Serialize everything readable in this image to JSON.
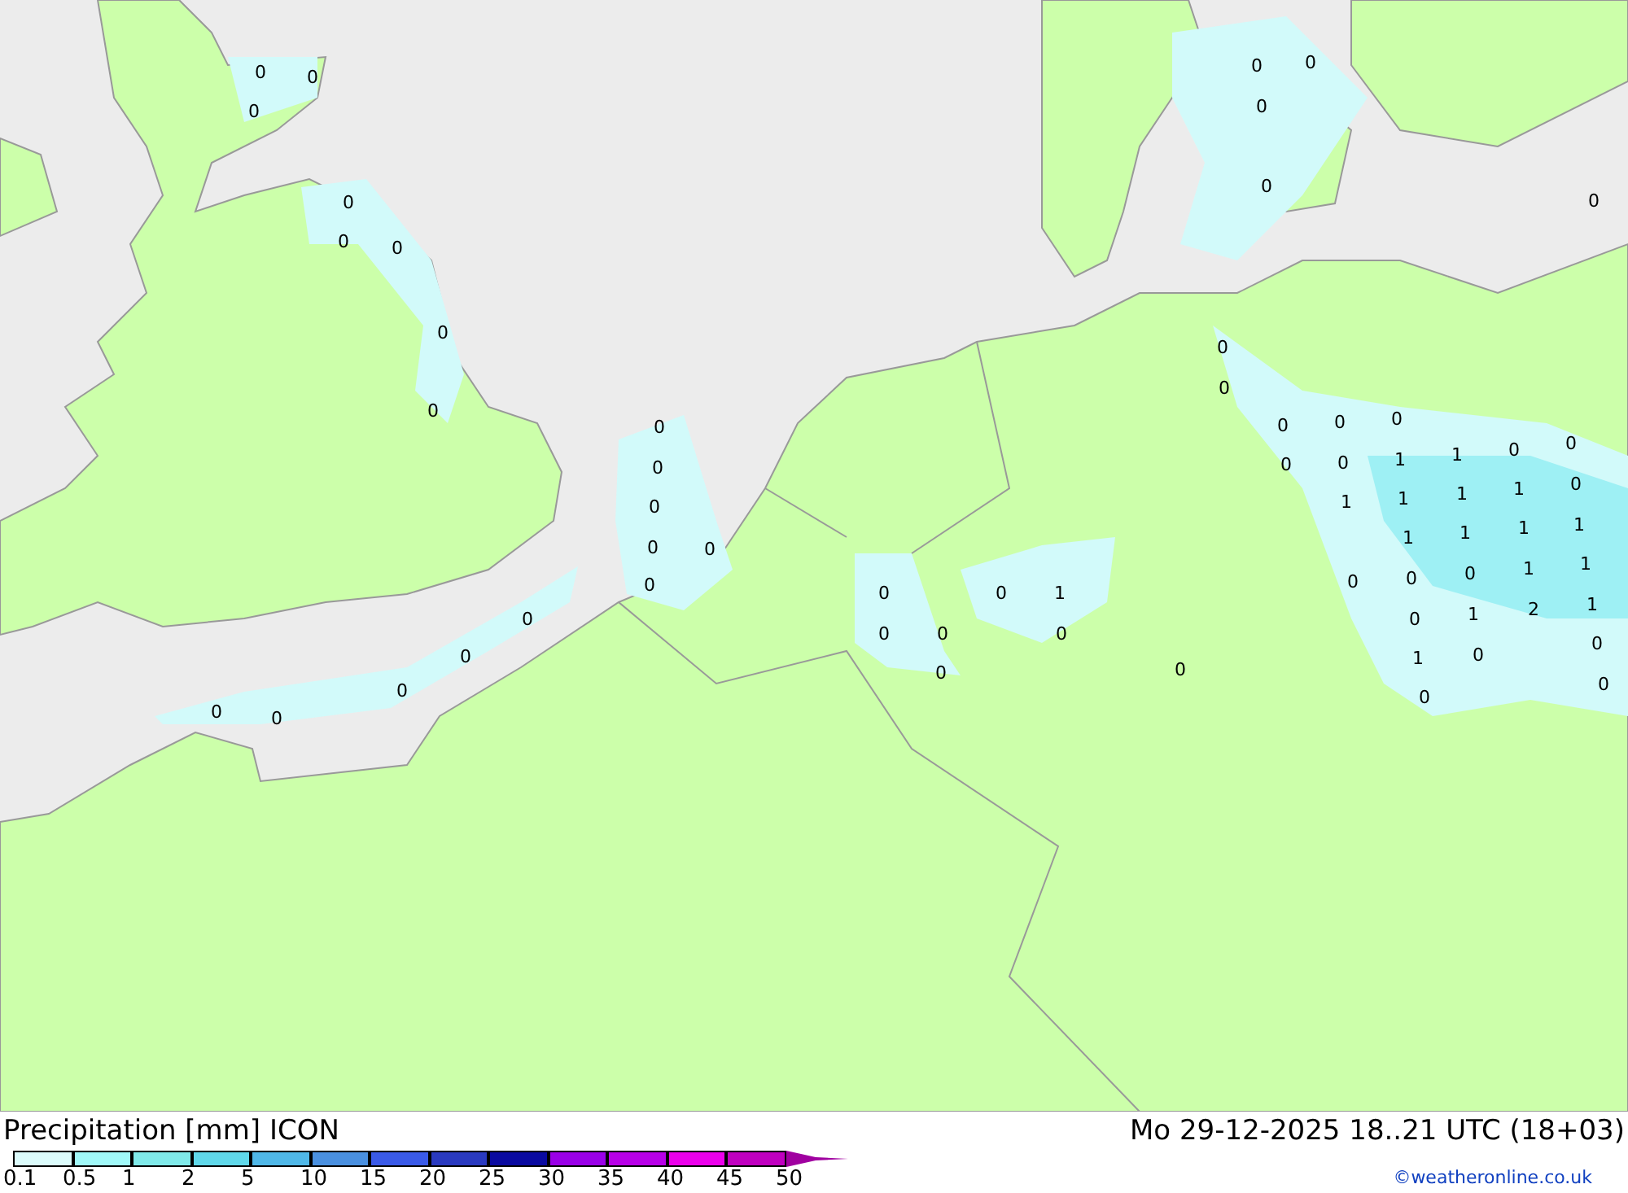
{
  "map": {
    "values": [
      "0",
      "0",
      "0",
      "0",
      "0",
      "0",
      "0",
      "0",
      "0",
      "0",
      "0",
      "0",
      "0",
      "0",
      "0",
      "0",
      "0",
      "0",
      "0",
      "0",
      "0",
      "0",
      "0",
      "0",
      "0",
      "0",
      "0",
      "0",
      "0",
      "0",
      "0",
      "1",
      "1",
      "0",
      "0",
      "0",
      "1",
      "1",
      "1",
      "1",
      "1",
      "1",
      "1",
      "1",
      "1",
      "0",
      "0",
      "0",
      "1",
      "0",
      "1",
      "2",
      "1",
      "0",
      "1",
      "0",
      "0",
      "0",
      "0",
      "0",
      "1",
      "0",
      "0",
      "0",
      "0",
      "0"
    ]
  },
  "footer": {
    "title": "Precipitation [mm] ICON",
    "valid_time": "Mo 29-12-2025 18..21 UTC (18+03)",
    "credit": "©weatheronline.co.uk"
  },
  "legend": {
    "bins": [
      {
        "color": "#dcfcfc"
      },
      {
        "color": "#a0f8f8"
      },
      {
        "color": "#80eaea"
      },
      {
        "color": "#60d8ea"
      },
      {
        "color": "#50b8e8"
      },
      {
        "color": "#4a90e0"
      },
      {
        "color": "#3a5ae8"
      },
      {
        "color": "#2a3ac0"
      },
      {
        "color": "#0a0aa0"
      },
      {
        "color": "#9a00e8"
      },
      {
        "color": "#b800e8"
      },
      {
        "color": "#ec00ec"
      },
      {
        "color": "#c000c0"
      }
    ],
    "labels": [
      "0.1",
      "0.5",
      "1",
      "2",
      "5",
      "10",
      "15",
      "20",
      "25",
      "30",
      "35",
      "40",
      "45",
      "50"
    ]
  }
}
